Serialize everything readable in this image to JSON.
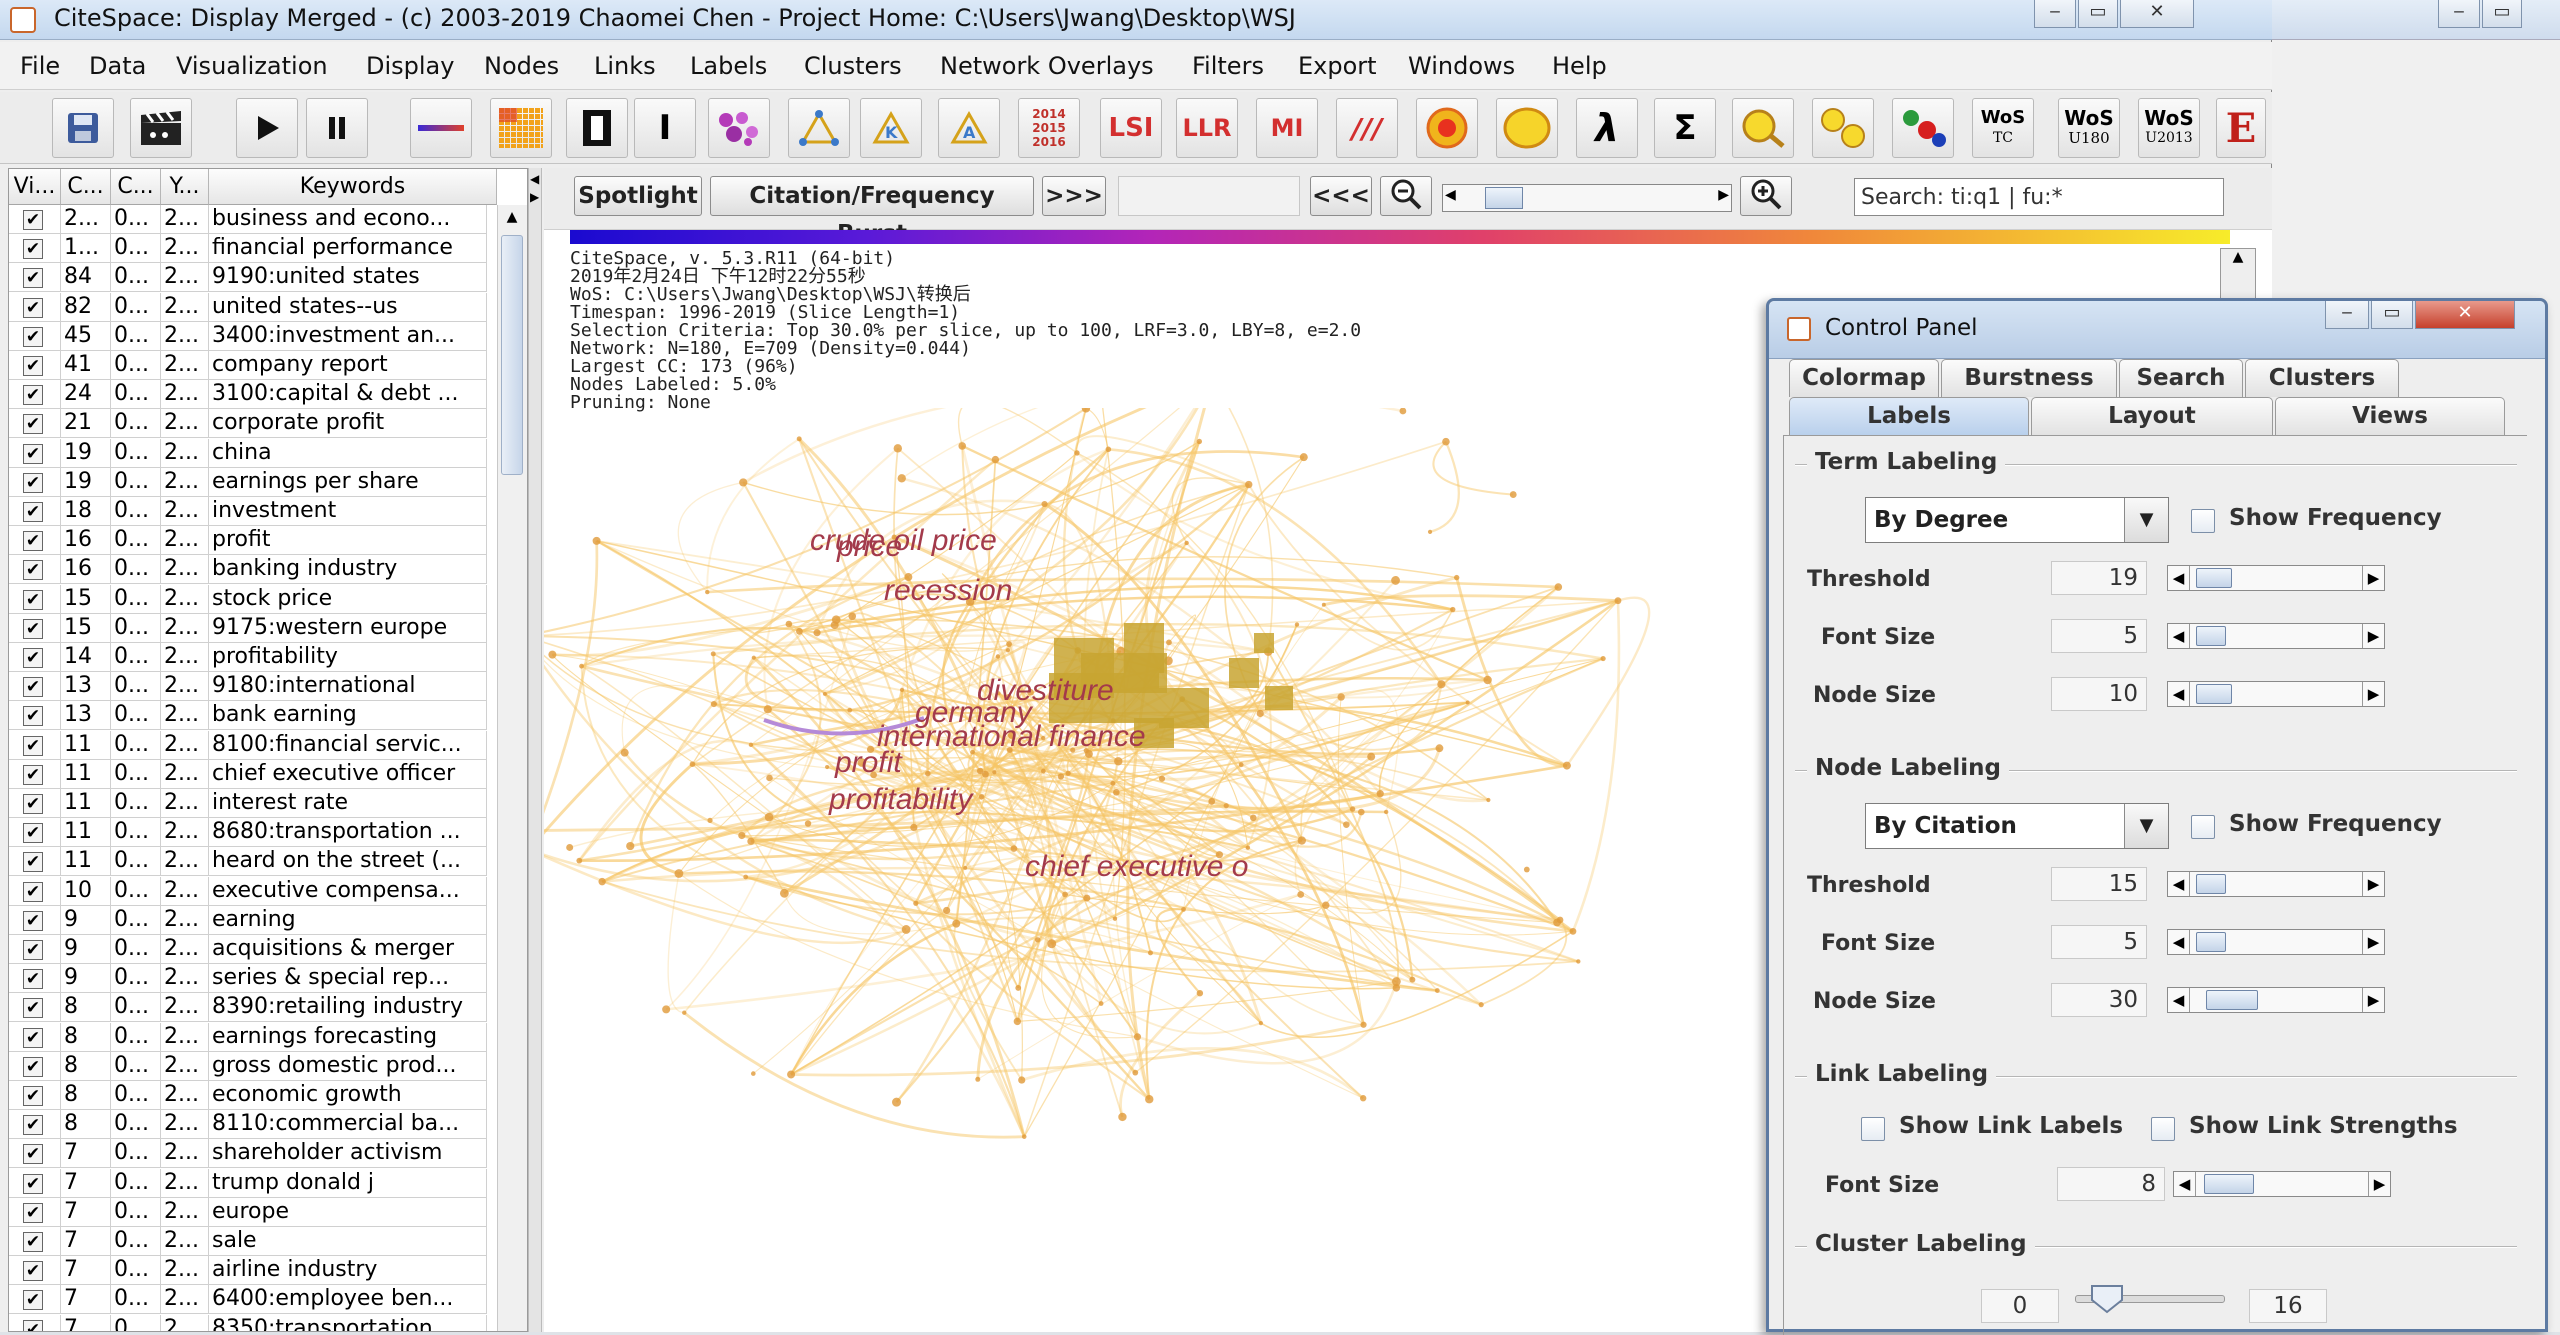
{
  "window": {
    "title": "CiteSpace: Display Merged - (c) 2003-2019 Chaomei Chen - Project Home: C:\\Users\\Jwang\\Desktop\\WSJ",
    "minimize": "‒",
    "maximize": "▭",
    "close": "✕"
  },
  "menu": [
    "File",
    "Data",
    "Visualization",
    "Display",
    "Nodes",
    "Links",
    "Labels",
    "Clusters",
    "Network Overlays",
    "Filters",
    "Export",
    "Windows",
    "Help"
  ],
  "toolbar": {
    "years": [
      "2014",
      "2015",
      "2016"
    ],
    "lsi": "LSI",
    "llr": "LLR",
    "mi": "MI",
    "slashes": "///",
    "lambda": "λ",
    "sigma": "Σ",
    "wos1": [
      "WoS",
      "TC"
    ],
    "wos2": [
      "WoS",
      "U180"
    ],
    "wos3": [
      "WoS",
      "U2013"
    ],
    "e": "E"
  },
  "table": {
    "headers": [
      "Vi...",
      "C...",
      "C...",
      "Y...",
      "Keywords"
    ],
    "rows": [
      {
        "count": "2...",
        "c2": "0...",
        "y": "2...",
        "keyword": "business and econo..."
      },
      {
        "count": "1...",
        "c2": "0...",
        "y": "2...",
        "keyword": "financial performance"
      },
      {
        "count": "84",
        "c2": "0...",
        "y": "2...",
        "keyword": "9190:united states"
      },
      {
        "count": "82",
        "c2": "0...",
        "y": "2...",
        "keyword": "united states--us"
      },
      {
        "count": "45",
        "c2": "0...",
        "y": "2...",
        "keyword": "3400:investment an..."
      },
      {
        "count": "41",
        "c2": "0...",
        "y": "2...",
        "keyword": "company report"
      },
      {
        "count": "24",
        "c2": "0...",
        "y": "2...",
        "keyword": "3100:capital & debt ..."
      },
      {
        "count": "21",
        "c2": "0...",
        "y": "2...",
        "keyword": "corporate profit"
      },
      {
        "count": "19",
        "c2": "0...",
        "y": "2...",
        "keyword": "china"
      },
      {
        "count": "19",
        "c2": "0...",
        "y": "2...",
        "keyword": "earnings per share"
      },
      {
        "count": "18",
        "c2": "0...",
        "y": "2...",
        "keyword": "investment"
      },
      {
        "count": "16",
        "c2": "0...",
        "y": "2...",
        "keyword": "profit"
      },
      {
        "count": "16",
        "c2": "0...",
        "y": "2...",
        "keyword": "banking industry"
      },
      {
        "count": "15",
        "c2": "0...",
        "y": "2...",
        "keyword": "stock price"
      },
      {
        "count": "15",
        "c2": "0...",
        "y": "2...",
        "keyword": "9175:western europe"
      },
      {
        "count": "14",
        "c2": "0...",
        "y": "2...",
        "keyword": "profitability"
      },
      {
        "count": "13",
        "c2": "0...",
        "y": "2...",
        "keyword": "9180:international"
      },
      {
        "count": "13",
        "c2": "0...",
        "y": "2...",
        "keyword": "bank earning"
      },
      {
        "count": "11",
        "c2": "0...",
        "y": "2...",
        "keyword": "8100:financial servic..."
      },
      {
        "count": "11",
        "c2": "0...",
        "y": "2...",
        "keyword": "chief executive officer"
      },
      {
        "count": "11",
        "c2": "0...",
        "y": "2...",
        "keyword": "interest rate"
      },
      {
        "count": "11",
        "c2": "0...",
        "y": "2...",
        "keyword": "8680:transportation ..."
      },
      {
        "count": "11",
        "c2": "0...",
        "y": "2...",
        "keyword": "heard on the street (..."
      },
      {
        "count": "10",
        "c2": "0...",
        "y": "2...",
        "keyword": "executive compensa..."
      },
      {
        "count": "9",
        "c2": "0...",
        "y": "2...",
        "keyword": "earning"
      },
      {
        "count": "9",
        "c2": "0...",
        "y": "2...",
        "keyword": "acquisitions & merger"
      },
      {
        "count": "9",
        "c2": "0...",
        "y": "2...",
        "keyword": "series & special rep..."
      },
      {
        "count": "8",
        "c2": "0...",
        "y": "2...",
        "keyword": "8390:retailing industry"
      },
      {
        "count": "8",
        "c2": "0...",
        "y": "2...",
        "keyword": "earnings forecasting"
      },
      {
        "count": "8",
        "c2": "0...",
        "y": "2...",
        "keyword": "gross domestic prod..."
      },
      {
        "count": "8",
        "c2": "0...",
        "y": "2...",
        "keyword": "economic growth"
      },
      {
        "count": "8",
        "c2": "0...",
        "y": "2...",
        "keyword": "8110:commercial ba..."
      },
      {
        "count": "7",
        "c2": "0...",
        "y": "2...",
        "keyword": "shareholder activism"
      },
      {
        "count": "7",
        "c2": "0...",
        "y": "2...",
        "keyword": "trump donald j"
      },
      {
        "count": "7",
        "c2": "0...",
        "y": "2...",
        "keyword": "europe"
      },
      {
        "count": "7",
        "c2": "0...",
        "y": "2...",
        "keyword": "sale"
      },
      {
        "count": "7",
        "c2": "0...",
        "y": "2...",
        "keyword": "airline industry"
      },
      {
        "count": "7",
        "c2": "0...",
        "y": "2...",
        "keyword": "6400:employee ben..."
      },
      {
        "count": "7",
        "c2": "0...",
        "y": "2...",
        "keyword": "8350:transportation ..."
      }
    ]
  },
  "vis": {
    "spotlight": "Spotlight",
    "burst": "Citation/Frequency Burst",
    "forward": ">>>",
    "back": "<<<",
    "search_value": "Search: ti:q1 | fu:*",
    "meta_lines": [
      "CiteSpace, v. 5.3.R11 (64-bit)",
      "2019年2月24日 下午12时22分55秒",
      "WoS: C:\\Users\\Jwang\\Desktop\\WSJ\\转换后",
      "Timespan: 1996-2019 (Slice Length=1)",
      "Selection Criteria: Top 30.0% per slice, up to 100, LRF=3.0, LBY=8, e=2.0",
      "Network: N=180, E=709 (Density=0.044)",
      "Largest CC: 173 (96%)",
      "Nodes Labeled: 5.0%",
      "Pruning: None"
    ],
    "labels": [
      "crude oil price",
      "price",
      "recession",
      "divestiture",
      "germany",
      "international finance",
      "profit",
      "profitability",
      "chief executive o"
    ]
  },
  "control_panel": {
    "title": "Control Panel",
    "tabs_top": [
      "Colormap",
      "Burstness",
      "Search",
      "Clusters"
    ],
    "tabs_bottom": [
      "Labels",
      "Layout",
      "Views"
    ],
    "term": {
      "title": "Term Labeling",
      "mode": "By Degree",
      "show_freq": "Show Frequency",
      "threshold_label": "Threshold",
      "threshold": "19",
      "font_label": "Font Size",
      "font": "5",
      "node_label": "Node Size",
      "node": "10"
    },
    "node": {
      "title": "Node Labeling",
      "mode": "By Citation",
      "show_freq": "Show Frequency",
      "threshold_label": "Threshold",
      "threshold": "15",
      "font_label": "Font Size",
      "font": "5",
      "node_label": "Node Size",
      "node": "30"
    },
    "link": {
      "title": "Link Labeling",
      "show_labels": "Show Link Labels",
      "show_strengths": "Show Link Strengths",
      "font_label": "Font Size",
      "font": "8"
    },
    "cluster": {
      "title": "Cluster Labeling",
      "min": "0",
      "max": "16"
    }
  },
  "colors": {
    "accent": "#5d7aa2",
    "node": "#c8a431",
    "label": "#a33a4b",
    "edge": "#f6c667"
  }
}
